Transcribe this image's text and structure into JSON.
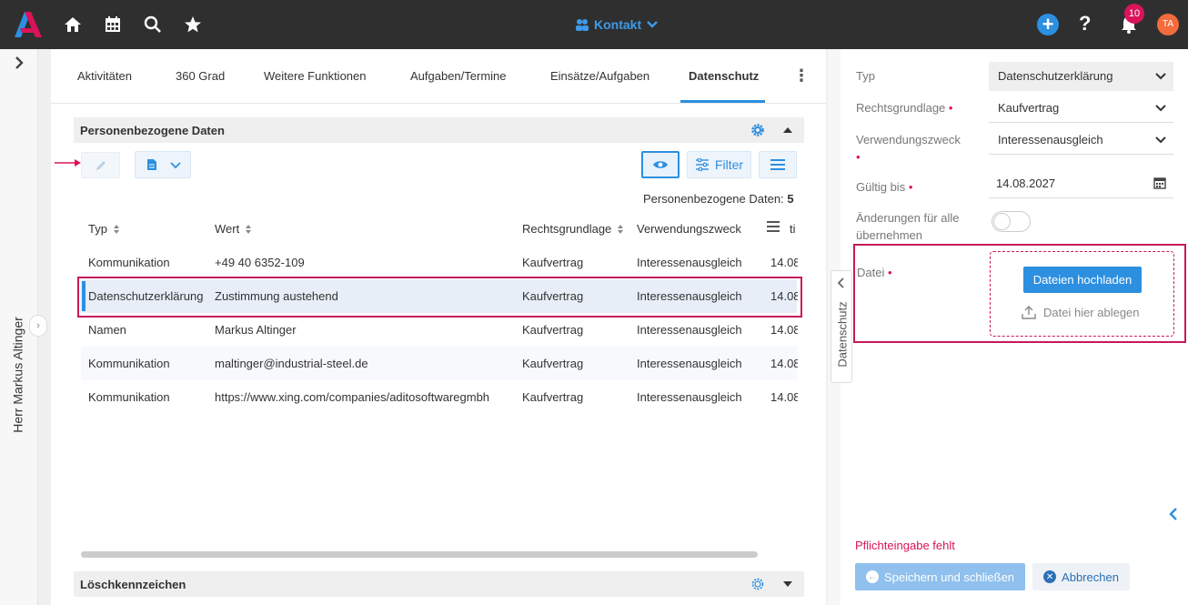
{
  "topbar": {
    "context_label": "Kontakt",
    "notification_count": "10",
    "avatar_initials": "TA",
    "accent_color": "#2c8fe0"
  },
  "left_panel": {
    "contact_name": "Herr Markus Altinger"
  },
  "tabs": [
    {
      "label": "Aktivitäten"
    },
    {
      "label": "360 Grad"
    },
    {
      "label": "Weitere Funktionen"
    },
    {
      "label": "Aufgaben/Termine"
    },
    {
      "label": "Einsätze/Aufgaben"
    },
    {
      "label": "Datenschutz",
      "active": true
    }
  ],
  "section_personal": {
    "title": "Personenbezogene Daten",
    "filter_label": "Filter",
    "count_label": "Personenbezogene Daten:",
    "count_value": "5"
  },
  "table": {
    "headers": [
      "Typ",
      "Wert",
      "Rechtsgrundlage",
      "Verwendungszweck",
      "ti"
    ],
    "rows": [
      {
        "typ": "Kommunikation",
        "wert": "+49 40 6352-109",
        "rechtsgrundlage": "Kaufvertrag",
        "zweck": "Interessenausgleich",
        "datum": "14.08"
      },
      {
        "typ": "Datenschutzerklärung",
        "wert": "Zustimmung austehend",
        "rechtsgrundlage": "Kaufvertrag",
        "zweck": "Interessenausgleich",
        "datum": "14.08",
        "selected": true
      },
      {
        "typ": "Namen",
        "wert": "Markus Altinger",
        "rechtsgrundlage": "Kaufvertrag",
        "zweck": "Interessenausgleich",
        "datum": "14.08"
      },
      {
        "typ": "Kommunikation",
        "wert": "maltinger@industrial-steel.de",
        "rechtsgrundlage": "Kaufvertrag",
        "zweck": "Interessenausgleich",
        "datum": "14.08"
      },
      {
        "typ": "Kommunikation",
        "wert": "https://www.xing.com/companies/aditosoftwaregmbh",
        "rechtsgrundlage": "Kaufvertrag",
        "zweck": "Interessenausgleich",
        "datum": "14.08"
      }
    ]
  },
  "section_delete": {
    "title": "Löschkennzeichen"
  },
  "side_tab": {
    "label": "Datenschutz"
  },
  "form": {
    "typ_label": "Typ",
    "typ_value": "Datenschutzerklärung",
    "rechtsgrundlage_label": "Rechtsgrundlage",
    "rechtsgrundlage_value": "Kaufvertrag",
    "zweck_label": "Verwendungszweck",
    "zweck_value": "Interessenausgleich",
    "gueltig_label": "Gültig bis",
    "gueltig_value": "14.08.2027",
    "aenderungen_label_1": "Änderungen für alle",
    "aenderungen_label_2": "übernehmen",
    "datei_label": "Datei",
    "upload_label": "Dateien hochladen",
    "drop_label": "Datei hier ablegen",
    "error_text": "Pflichteingabe fehlt",
    "save_label": "Speichern und schließen",
    "cancel_label": "Abbrechen",
    "required_marker": "•"
  }
}
